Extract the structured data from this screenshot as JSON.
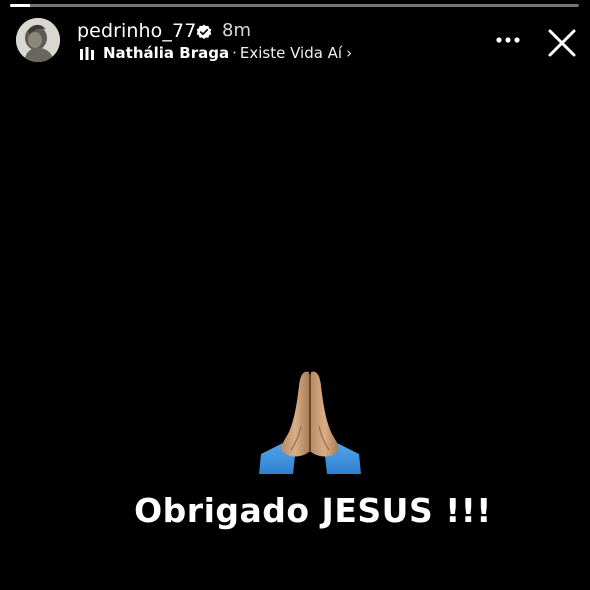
{
  "story": {
    "progress_fraction": 0.035,
    "username": "pedrinho_77",
    "time_ago": "8m",
    "music": {
      "artist": "Nathália Braga",
      "separator": "·",
      "song": "Existe Vida Aí",
      "chevron": "›"
    },
    "caption": "Obrigado JESUS !!!"
  },
  "icons": {
    "verified": "verified-badge-icon",
    "music": "music-bars-icon",
    "more": "more-options-icon",
    "close": "close-icon",
    "emoji": "folded-hands-emoji"
  },
  "colors": {
    "background": "#000000",
    "text": "#ffffff"
  }
}
